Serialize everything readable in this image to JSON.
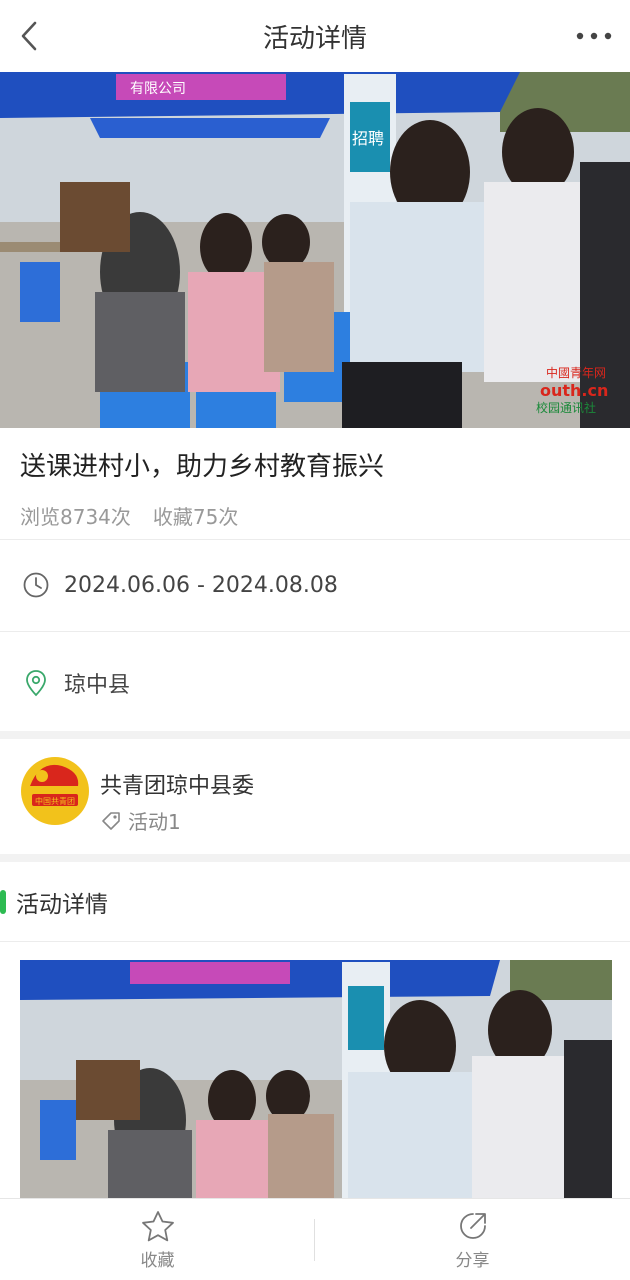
{
  "header": {
    "title": "活动详情",
    "back_icon": "chevron-left-icon",
    "more_icon": "more-dots-icon"
  },
  "hero": {
    "banner_text": "有限公司",
    "sign_text": "招聘",
    "watermark_line1": "中國青年网",
    "watermark_line2": "outh.cn",
    "watermark_line3": "校园通讯社"
  },
  "event": {
    "title": "送课进村小，助力乡村教育振兴",
    "views": "浏览8734次",
    "favorites": "收藏75次",
    "date_range": "2024.06.06 - 2024.08.08",
    "location": "琼中县"
  },
  "organizer": {
    "name": "共青团琼中县委",
    "tag": "活动1",
    "logo_text": "中国共青团"
  },
  "section": {
    "title": "活动详情"
  },
  "bottom_bar": {
    "favorite_label": "收藏",
    "share_label": "分享"
  },
  "colors": {
    "accent_green": "#2dbb52",
    "tent_blue": "#1f4fbf",
    "logo_red": "#d9261c",
    "logo_gold": "#f2c21b"
  }
}
